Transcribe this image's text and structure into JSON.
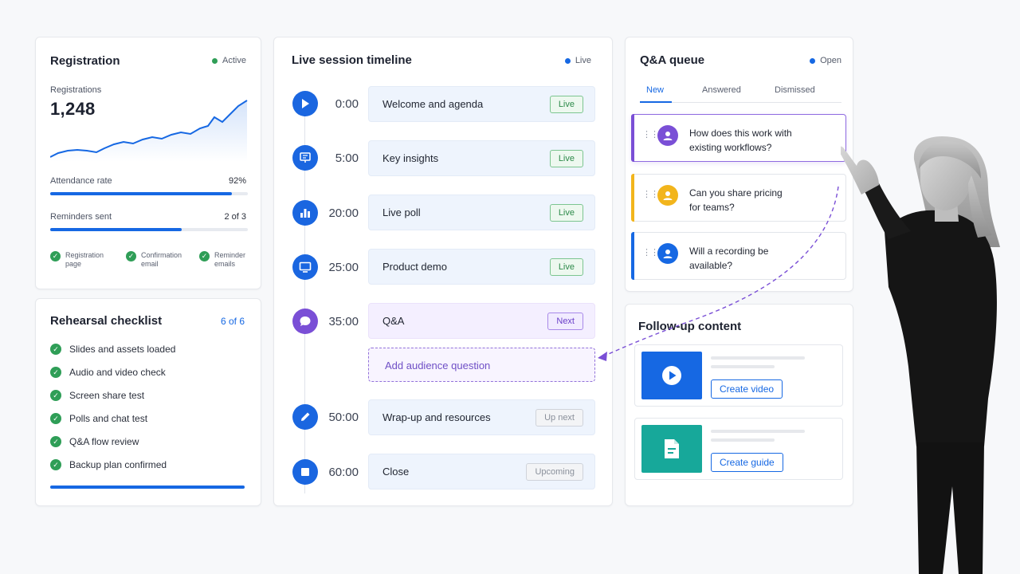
{
  "registration": {
    "title": "Registration",
    "status": "Active",
    "metric_label": "Registrations",
    "metric_value": "1,248",
    "attendance_label": "Attendance rate",
    "attendance_value": "92%",
    "attendance_fraction": 0.92,
    "reminders_label": "Reminders sent",
    "reminders_value": "2 of 3",
    "reminders_fraction": 0.667,
    "steps": [
      {
        "line1": "Registration",
        "line2": "page"
      },
      {
        "line1": "Confirmation",
        "line2": "email"
      },
      {
        "line1": "Reminder",
        "line2": "emails"
      }
    ]
  },
  "rehearsal": {
    "title": "Rehearsal checklist",
    "count": "6 of 6",
    "items": [
      "Slides and assets loaded",
      "Audio and video check",
      "Screen share test",
      "Polls and chat test",
      "Q&A flow review",
      "Backup plan confirmed"
    ]
  },
  "timeline": {
    "title": "Live session timeline",
    "status": "Live",
    "items": [
      {
        "time": "0:00",
        "label": "Welcome and agenda",
        "badge": "Live",
        "icon": "play-icon"
      },
      {
        "time": "5:00",
        "label": "Key insights",
        "badge": "Live",
        "icon": "presentation-icon"
      },
      {
        "time": "20:00",
        "label": "Live poll",
        "badge": "Live",
        "icon": "bar-chart-icon"
      },
      {
        "time": "25:00",
        "label": "Product demo",
        "badge": "Live",
        "icon": "monitor-icon"
      },
      {
        "time": "35:00",
        "label": "Q&A",
        "badge": "Next",
        "icon": "chat-bubble-icon"
      },
      {
        "time": "50:00",
        "label": "Wrap-up and resources",
        "badge": "Up next",
        "icon": "pencil-icon"
      },
      {
        "time": "60:00",
        "label": "Close",
        "badge": "Upcoming",
        "icon": "stop-icon"
      }
    ],
    "add_question": "Add audience question"
  },
  "qa": {
    "title": "Q&A queue",
    "status": "Open",
    "tabs": [
      "New",
      "Answered",
      "Dismissed"
    ],
    "questions": [
      {
        "line1": "How does this work with",
        "line2": "existing workflows?"
      },
      {
        "line1": "Can you share pricing",
        "line2": "for teams?"
      },
      {
        "line1": "Will a recording be",
        "line2": "available?"
      }
    ]
  },
  "followup": {
    "title": "Follow-up content",
    "video_button": "Create video",
    "guide_button": "Create guide"
  },
  "colors": {
    "accent": "#1668e3",
    "success": "#2f9e57",
    "purple": "#7a4fd6",
    "amber": "#f2b51c",
    "teal": "#17a89a"
  }
}
